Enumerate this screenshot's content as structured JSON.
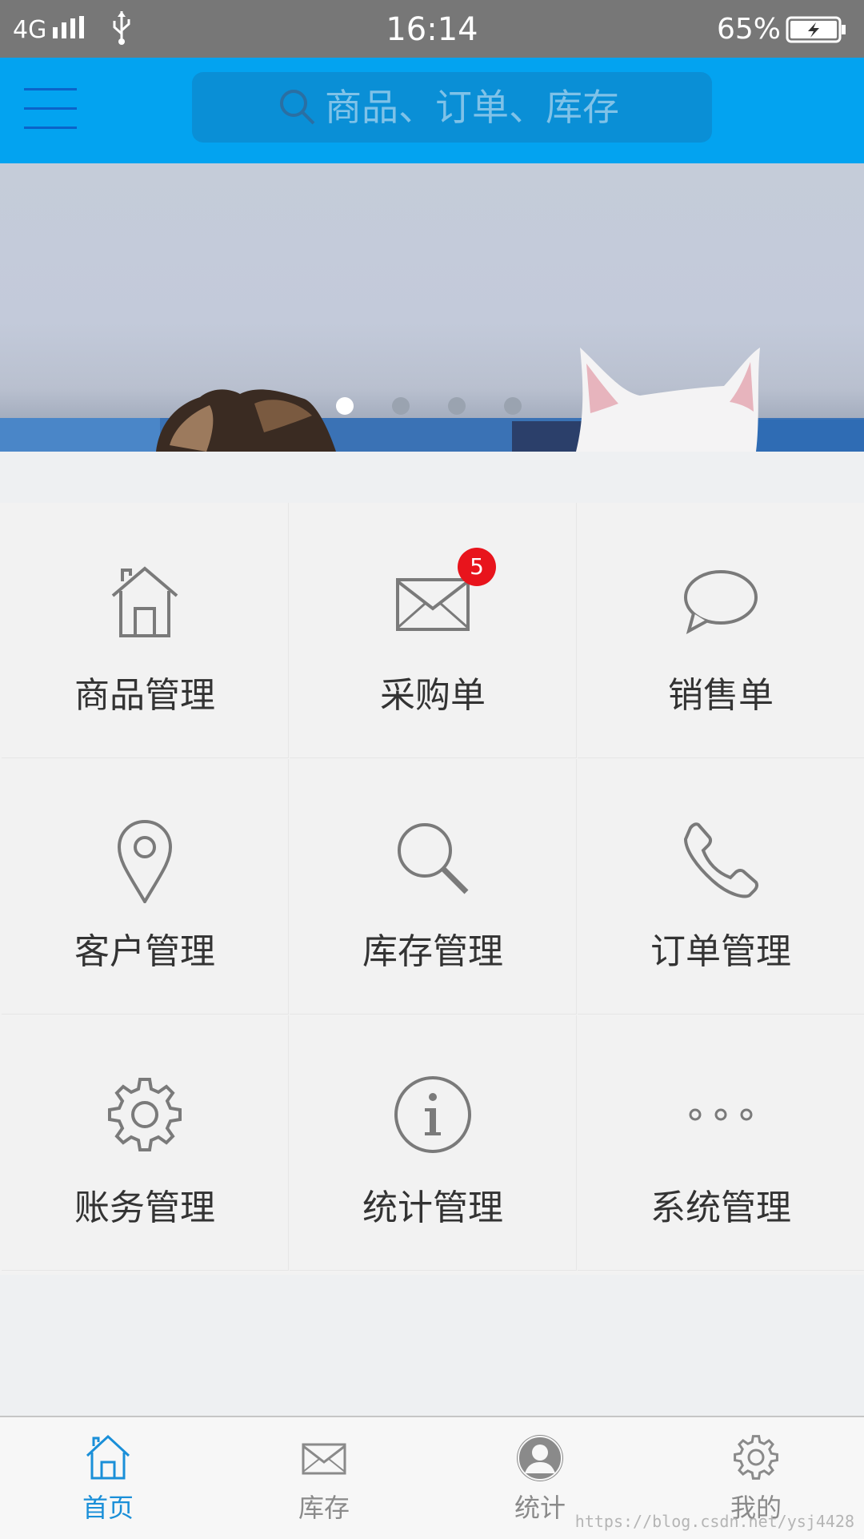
{
  "status_bar": {
    "network": "4G",
    "time": "16:14",
    "battery": "65%"
  },
  "header": {
    "search_placeholder": "商品、订单、库存",
    "accent_color": "#03a3f0"
  },
  "banner": {
    "slide_count": 4,
    "active_slide": 1
  },
  "grid": {
    "items": [
      {
        "label": "商品管理",
        "icon": "house-icon"
      },
      {
        "label": "采购单",
        "icon": "mail-icon",
        "badge": "5"
      },
      {
        "label": "销售单",
        "icon": "chat-bubble-icon"
      },
      {
        "label": "客户管理",
        "icon": "location-pin-icon"
      },
      {
        "label": "库存管理",
        "icon": "search-icon"
      },
      {
        "label": "订单管理",
        "icon": "phone-icon"
      },
      {
        "label": "账务管理",
        "icon": "gear-icon"
      },
      {
        "label": "统计管理",
        "icon": "info-icon"
      },
      {
        "label": "系统管理",
        "icon": "more-icon"
      }
    ]
  },
  "tabbar": {
    "tabs": [
      {
        "label": "首页",
        "icon": "home-icon",
        "active": true
      },
      {
        "label": "库存",
        "icon": "mail-icon",
        "active": false
      },
      {
        "label": "统计",
        "icon": "user-icon",
        "active": false
      },
      {
        "label": "我的",
        "icon": "gear-icon",
        "active": false
      }
    ],
    "active_color": "#1a8fd8"
  },
  "watermark": "https://blog.csdn.net/ysj4428"
}
